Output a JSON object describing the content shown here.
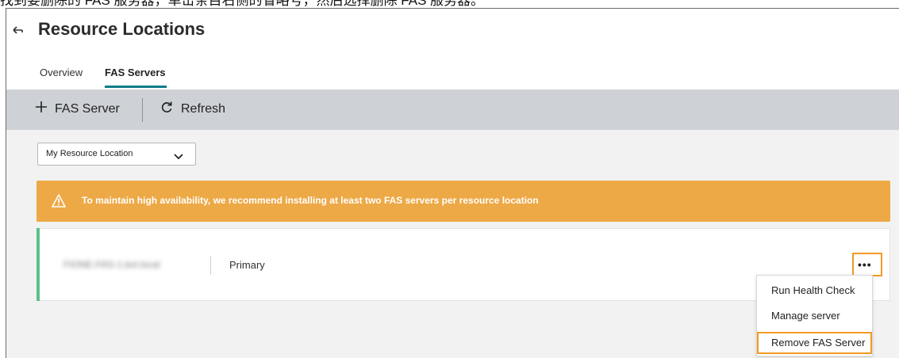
{
  "caption": "找到要删除的 FAS 服务器，单击条目右侧的省略号，然后选择删除 FAS 服务器。",
  "header": {
    "title": "Resource Locations",
    "back_icon": "back-arrow-icon"
  },
  "tabs": [
    {
      "label": "Overview",
      "active": false
    },
    {
      "label": "FAS Servers",
      "active": true
    }
  ],
  "toolbar": {
    "add_label": "FAS Server",
    "add_icon": "plus-icon",
    "refresh_label": "Refresh",
    "refresh_icon": "refresh-icon"
  },
  "location_select": {
    "value": "My Resource Location",
    "icon": "chevron-down-icon"
  },
  "banner": {
    "icon": "warning-icon",
    "text": "To maintain high availability, we recommend installing at least two FAS servers per resource location"
  },
  "server": {
    "name": "FIONE-FAS-1.bvt.local",
    "role": "Primary",
    "more_label": "•••"
  },
  "context_menu": {
    "items": [
      "Run Health Check",
      "Manage server",
      "Remove FAS Server"
    ]
  },
  "colors": {
    "accent_tab": "#127c8a",
    "toolbar_bg": "#ced2d6",
    "banner_bg": "#eda946",
    "highlight": "#f29a23",
    "status_accent": "#5cc08a"
  }
}
